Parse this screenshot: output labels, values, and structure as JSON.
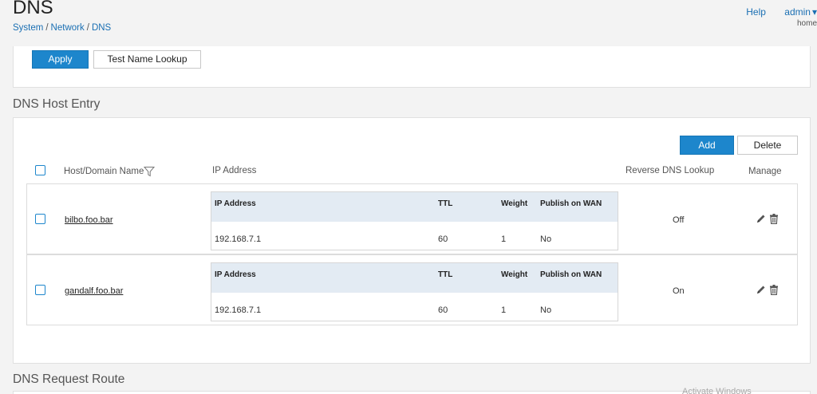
{
  "header": {
    "title": "DNS",
    "breadcrumb": [
      "System",
      "Network",
      "DNS"
    ],
    "help_label": "Help",
    "user_label": "admin",
    "home_label": "home"
  },
  "top_panel": {
    "apply_label": "Apply",
    "lookup_label": "Test Name Lookup"
  },
  "host_entry": {
    "section_title": "DNS Host Entry",
    "add_label": "Add",
    "delete_label": "Delete",
    "columns": {
      "host": "Host/Domain Name",
      "ip": "IP Address",
      "rdns": "Reverse DNS Lookup",
      "manage": "Manage"
    },
    "sub_columns": {
      "ip": "IP Address",
      "ttl": "TTL",
      "weight": "Weight",
      "publish": "Publish on WAN"
    },
    "rows": [
      {
        "host": "bilbo.foo.bar",
        "ip": "192.168.7.1",
        "ttl": "60",
        "weight": "1",
        "publish": "No",
        "rdns": "Off"
      },
      {
        "host": "gandalf.foo.bar",
        "ip": "192.168.7.1",
        "ttl": "60",
        "weight": "1",
        "publish": "No",
        "rdns": "On"
      }
    ]
  },
  "request_route": {
    "section_title": "DNS Request Route"
  },
  "watermark": "Activate Windows",
  "colors": {
    "accent": "#1d86cc",
    "sub_header_bg": "#e3ebf3"
  },
  "icons": [
    "filter-icon",
    "pencil-icon",
    "trash-icon"
  ]
}
